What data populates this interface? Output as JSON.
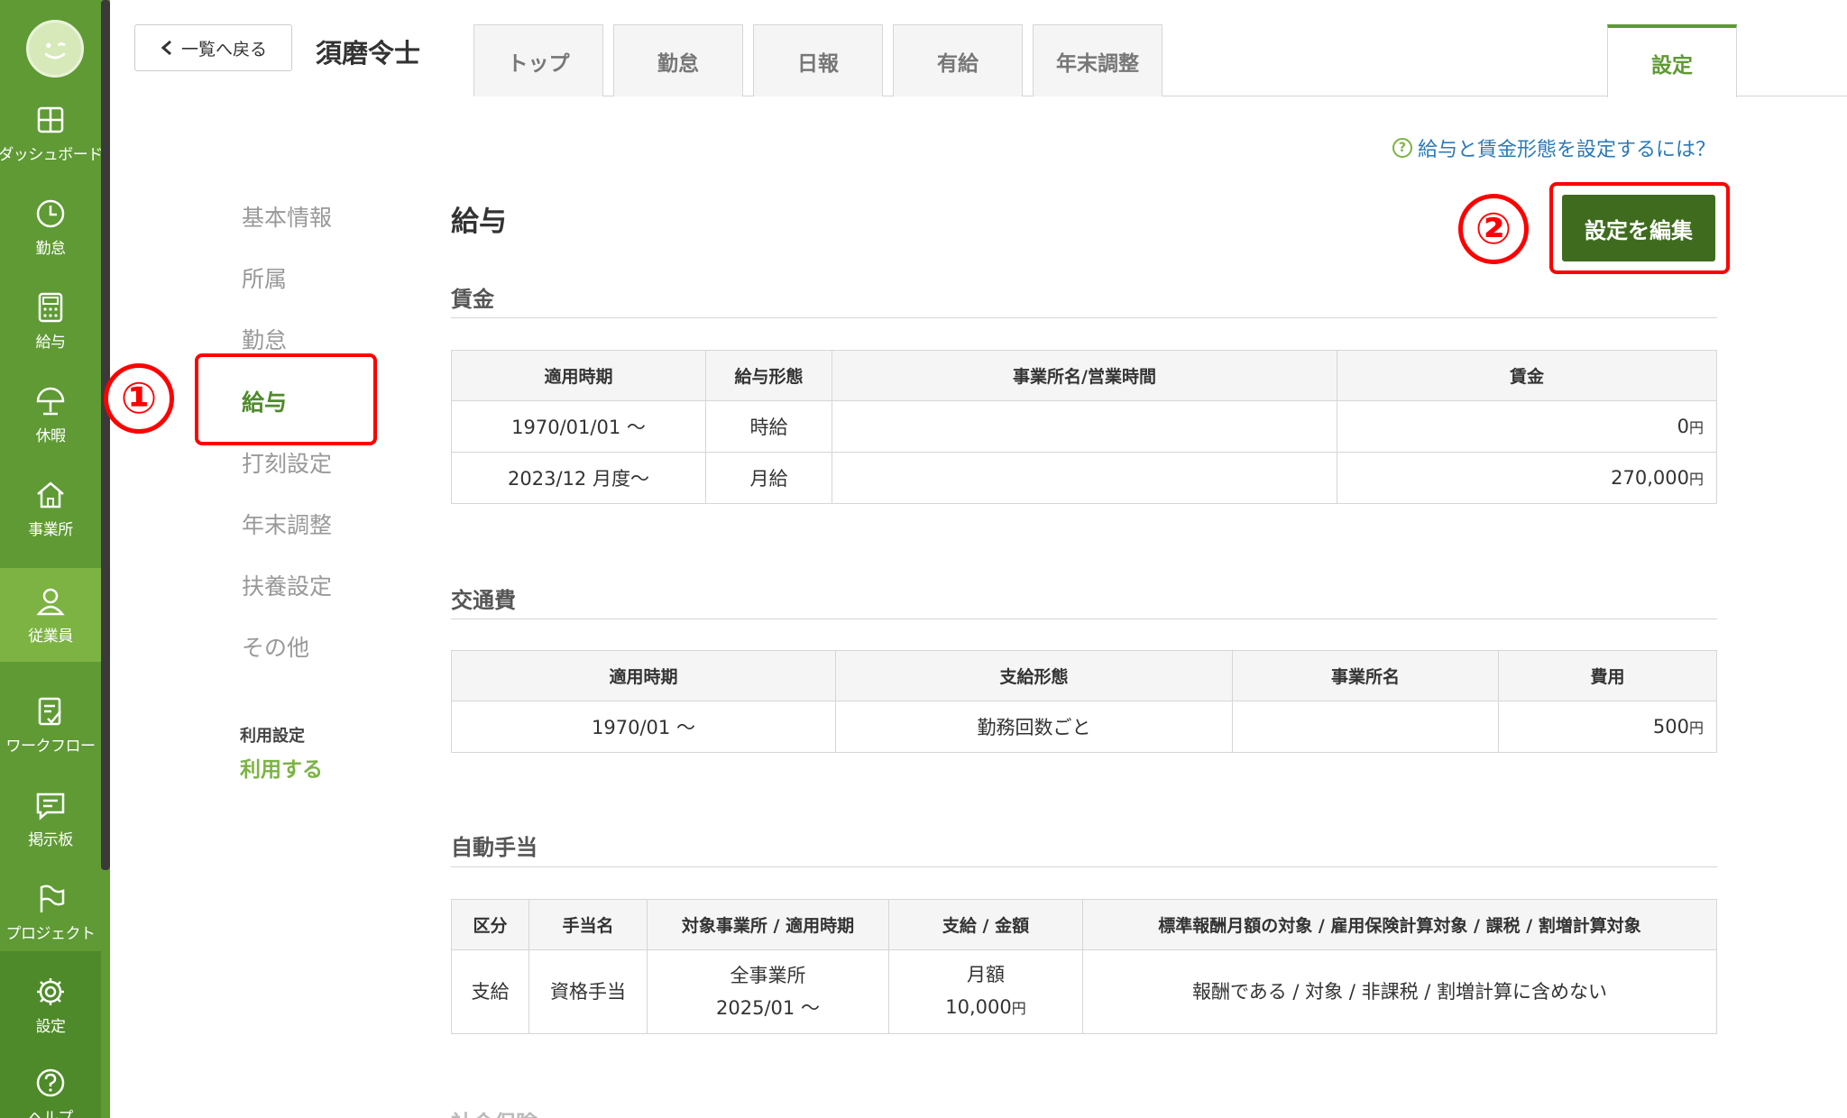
{
  "sidebar": {
    "items": [
      {
        "label": "ダッシュボード",
        "icon": "dashboard-icon"
      },
      {
        "label": "勤怠",
        "icon": "clock-icon"
      },
      {
        "label": "給与",
        "icon": "calculator-icon"
      },
      {
        "label": "休暇",
        "icon": "umbrella-icon"
      },
      {
        "label": "事業所",
        "icon": "home-icon"
      },
      {
        "label": "従業員",
        "icon": "person-icon"
      },
      {
        "label": "ワークフロー",
        "icon": "checklist-icon"
      },
      {
        "label": "掲示板",
        "icon": "chat-icon"
      },
      {
        "label": "プロジェクト",
        "icon": "flag-icon"
      },
      {
        "label": "設定",
        "icon": "gear-icon"
      },
      {
        "label": "ヘルプ",
        "icon": "help-icon"
      }
    ],
    "active_index": 5
  },
  "header": {
    "back_label": "一覧へ戻る",
    "employee_name": "須磨令士",
    "tabs": [
      "トップ",
      "勤怠",
      "日報",
      "有給",
      "年末調整"
    ],
    "settings_tab": "設定"
  },
  "help_link": "給与と賃金形態を設定するには？",
  "submenu": {
    "items": [
      "基本情報",
      "所属",
      "勤怠",
      "給与",
      "打刻設定",
      "年末調整",
      "扶養設定",
      "その他"
    ],
    "active": "給与",
    "usage_label": "利用設定",
    "usage_value": "利用する"
  },
  "annotations": {
    "one": "①",
    "two": "②"
  },
  "main": {
    "title": "給与",
    "edit_button": "設定を編集",
    "wage": {
      "title": "賃金",
      "headers": [
        "適用時期",
        "給与形態",
        "事業所名/営業時間",
        "賃金"
      ],
      "rows": [
        {
          "period": "1970/01/01 ～",
          "type": "時給",
          "office": "",
          "amount": "0",
          "unit": "円"
        },
        {
          "period": "2023/12 月度～",
          "type": "月給",
          "office": "",
          "amount": "270,000",
          "unit": "円"
        }
      ]
    },
    "transport": {
      "title": "交通費",
      "headers": [
        "適用時期",
        "支給形態",
        "事業所名",
        "費用"
      ],
      "rows": [
        {
          "period": "1970/01 ～",
          "type": "勤務回数ごと",
          "office": "",
          "amount": "500",
          "unit": "円"
        }
      ]
    },
    "allowance": {
      "title": "自動手当",
      "headers": [
        "区分",
        "手当名",
        "対象事業所 / 適用時期",
        "支給 / 金額",
        "標準報酬月額の対象 / 雇用保険計算対象 / 課税 / 割増計算対象"
      ],
      "rows": [
        {
          "category": "支給",
          "name": "資格手当",
          "office": "全事業所",
          "period": "2025/01 ～",
          "pay_type": "月額",
          "amount": "10,000",
          "unit": "円",
          "flags": "報酬である / 対象 / 非課税 / 割増計算に含めない"
        }
      ]
    },
    "next_section_title": "社会保険"
  }
}
